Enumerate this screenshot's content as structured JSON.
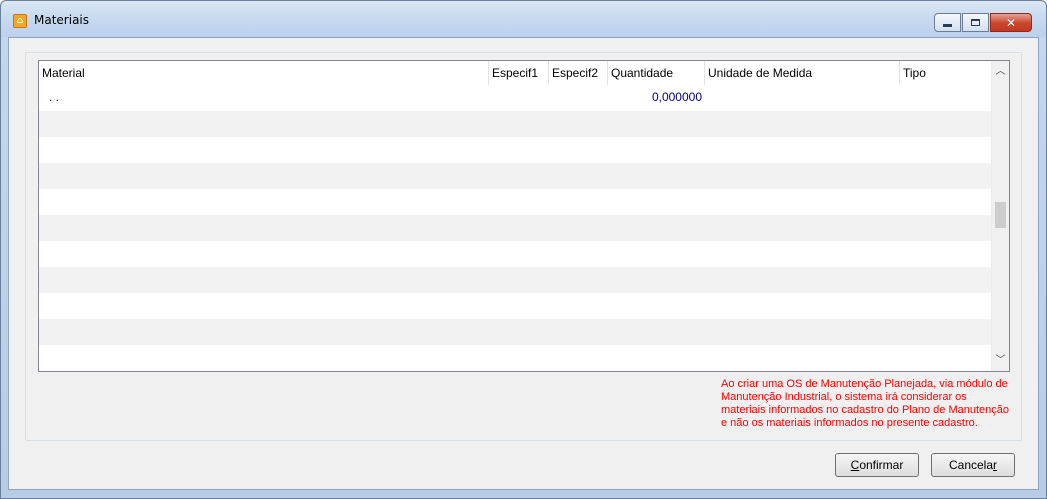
{
  "window": {
    "title": "Materiais",
    "app_icon": "app-logo-icon",
    "controls": {
      "minimize": "minimize-icon",
      "maximize": "maximize-icon",
      "close": "close-icon"
    }
  },
  "grid": {
    "columns": [
      "Material",
      "Especif1",
      "Especif2",
      "Quantidade",
      "Unidade de Medida",
      "Tipo"
    ],
    "rows": [
      {
        "material": ". .",
        "especif1": "",
        "especif2": "",
        "quantidade": "0,000000",
        "unidade": "",
        "tipo": ""
      }
    ],
    "empty_rows": 10,
    "scrollbar": {
      "up": "chevron-up-icon",
      "down": "chevron-down-icon"
    }
  },
  "notice": "Ao criar uma OS de Manutenção Planejada, via módulo de Manutenção Industrial, o sistema irá considerar os materiais informados no cadastro do Plano de Manutenção e não os materiais informados no presente cadastro.",
  "buttons": {
    "confirm_first": "C",
    "confirm_rest": "onfirmar",
    "cancel_first": "Cancela",
    "cancel_u": "r"
  },
  "colors": {
    "notice_text": "#ff0000",
    "number_text": "#000080",
    "close_button": "#c9452d"
  }
}
